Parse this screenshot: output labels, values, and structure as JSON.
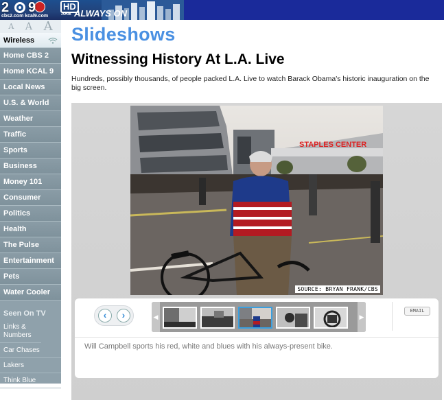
{
  "header": {
    "logo_2": "2",
    "logo_9": "9",
    "logo_hd": "HD",
    "url_cbs": "cbs2.com",
    "url_kcal": "kcal9.com",
    "tagline_prefix": "ARE",
    "tagline": "ALWAYS ON",
    "bar_color": "#1a2a9a"
  },
  "sidebar": {
    "font_sizes": [
      "A",
      "A",
      "A"
    ],
    "wireless_label": "Wireless",
    "nav": [
      "Home CBS 2",
      "Home KCAL 9",
      "Local News",
      "U.S. & World",
      "Weather",
      "Traffic",
      "Sports",
      "Business",
      "Money 101",
      "Consumer",
      "Politics",
      "Health",
      "The Pulse",
      "Entertainment",
      "Pets",
      "Water Cooler"
    ],
    "seen_on_tv_heading": "Seen On TV",
    "seen_on_tv": [
      "Links & Numbers",
      "Car Chases",
      "Lakers",
      "Think Blue"
    ]
  },
  "main": {
    "section_title": "Slideshows",
    "headline": "Witnessing History At L.A. Live",
    "dek": "Hundreds, possibly thousands, of people packed L.A. Live to watch Barack Obama's historic inauguration on the big screen.",
    "photo_sign": "STAPLES CENTER",
    "photo_credit": "SOURCE: BRYAN FRANK/CBS",
    "email_label": "EMAIL",
    "caption": "Will Campbell sports his red, white and blues with his always-present bike.",
    "accent_color": "#4a90e2"
  }
}
